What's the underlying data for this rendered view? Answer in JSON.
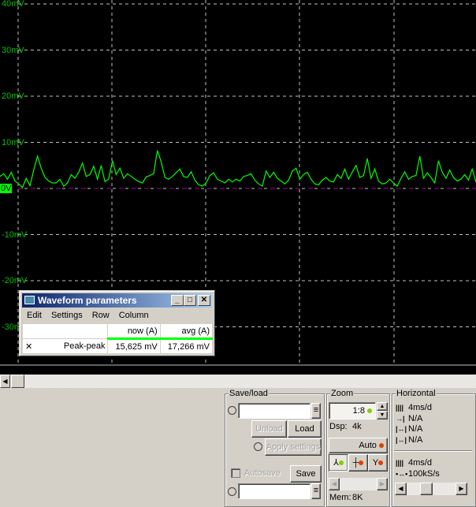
{
  "scope": {
    "y_labels": [
      "40mV",
      "30mV",
      "20mV",
      "10mV",
      "0V",
      "-10mV",
      "-20mV",
      "-30mV"
    ],
    "trace_color": "#00ff00",
    "grid_color": "#c0c0c0",
    "reference_color": "#a000a0",
    "trace_mV": [
      2.6,
      3.2,
      2.0,
      3.5,
      1.6,
      1.0,
      0.2,
      2.2,
      0.6,
      4.0,
      7.0,
      4.4,
      2.4,
      1.6,
      1.2,
      1.2,
      2.0,
      0.5,
      1.2,
      3.0,
      2.2,
      3.5,
      5.5,
      2.6,
      3.0,
      4.8,
      2.0,
      5.0,
      1.5,
      2.0,
      6.0,
      3.0,
      4.4,
      2.2,
      3.2,
      2.6,
      2.0,
      1.5,
      1.2,
      2.5,
      2.8,
      3.2,
      8.2,
      5.8,
      2.4,
      2.0,
      2.6,
      3.4,
      4.2,
      2.6,
      2.4,
      3.6,
      1.8,
      0.8,
      0.5,
      1.2,
      2.8,
      3.4,
      2.0,
      1.6,
      1.2,
      2.0,
      1.4,
      2.0,
      1.6,
      2.6,
      2.8,
      3.2,
      1.8,
      1.0,
      0.5,
      3.8,
      2.4,
      3.5,
      2.2,
      1.6,
      1.0,
      1.8,
      3.8,
      4.4,
      2.0,
      3.0,
      3.5,
      2.0,
      1.0,
      0.8,
      1.8,
      2.4,
      1.6,
      1.4,
      3.0,
      2.2,
      4.2,
      2.0,
      3.6,
      5.0,
      2.4,
      2.8,
      6.5,
      2.2,
      4.2,
      1.6,
      1.0,
      1.2,
      2.0,
      1.2,
      0.5,
      2.2,
      3.6,
      2.0,
      2.6,
      2.8,
      7.0,
      2.2,
      3.4,
      2.4,
      1.2,
      6.0,
      3.5,
      2.2,
      4.0,
      2.4,
      1.6,
      2.0,
      3.0,
      1.8,
      4.2,
      1.4
    ]
  },
  "waveform_parameters": {
    "title": "Waveform parameters",
    "menu": [
      "Edit",
      "Settings",
      "Row",
      "Column"
    ],
    "columns": [
      "",
      "now (A)",
      "avg (A)"
    ],
    "rows": [
      {
        "marker": "✕",
        "name": "Peak-peak",
        "now": "15,625 mV",
        "avg": "17,266 mV"
      }
    ]
  },
  "save_load": {
    "title": "Save/load",
    "unload": "Unload",
    "load": "Load",
    "apply_settings": "Apply settings",
    "autosave": "Autosave",
    "autosave_checked": false,
    "save": "Save",
    "top_file": "",
    "bottom_file": ""
  },
  "zoom": {
    "title": "Zoom",
    "ratio": "1:8",
    "dsp_label": "Dsp:",
    "dsp_value": "4k",
    "auto": "Auto",
    "mem_label": "Mem:",
    "mem_value": "8K"
  },
  "horizontal": {
    "title": "Horizontal",
    "time_div": "4ms/d",
    "delay": "N/A",
    "cursor1": "N/A",
    "cursor2": "N/A",
    "time_div2": "4ms/d",
    "sample_rate": "100kS/s"
  }
}
